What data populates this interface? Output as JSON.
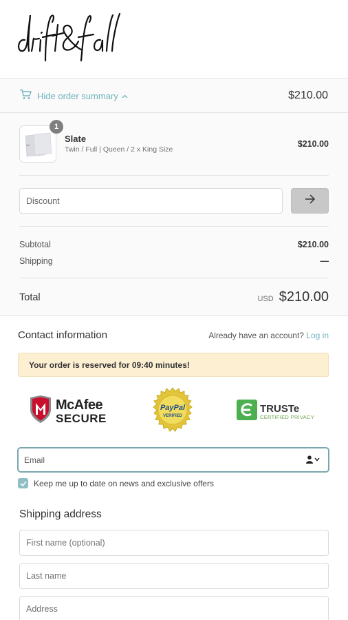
{
  "brand": {
    "logo_text": "drift&fall"
  },
  "summary_toggle": {
    "label": "Hide order summary",
    "total": "$210.00"
  },
  "product": {
    "quantity": "1",
    "name": "Slate",
    "variant": "Twin / Full | Queen / 2 x King Size",
    "price": "$210.00"
  },
  "discount": {
    "placeholder": "Discount"
  },
  "totals": {
    "subtotal_label": "Subtotal",
    "subtotal_value": "$210.00",
    "shipping_label": "Shipping",
    "shipping_value": "—",
    "total_label": "Total",
    "currency": "USD",
    "total_value": "$210.00"
  },
  "contact": {
    "title": "Contact information",
    "account_prompt": "Already have an account?",
    "login_link": "Log in"
  },
  "reservation": {
    "message": "Your order is reserved for 09:40 minutes!"
  },
  "trust_badges": {
    "mcafee_name": "McAfee",
    "mcafee_secure": "SECURE",
    "paypal_top": "PayPal",
    "paypal_bottom": "VERIFIED",
    "truste_name": "TRUSTe",
    "truste_sub": "CERTIFIED PRIVACY"
  },
  "email": {
    "placeholder": "Email"
  },
  "newsletter": {
    "label": "Keep me up to date on news and exclusive offers",
    "checked": true
  },
  "shipping": {
    "title": "Shipping address",
    "first_name_placeholder": "First name (optional)",
    "last_name_placeholder": "Last name",
    "address_placeholder": "Address"
  },
  "colors": {
    "accent": "#6fb3bd",
    "reserved_bg": "#fcefd2",
    "checkbox": "#8fbec5"
  }
}
